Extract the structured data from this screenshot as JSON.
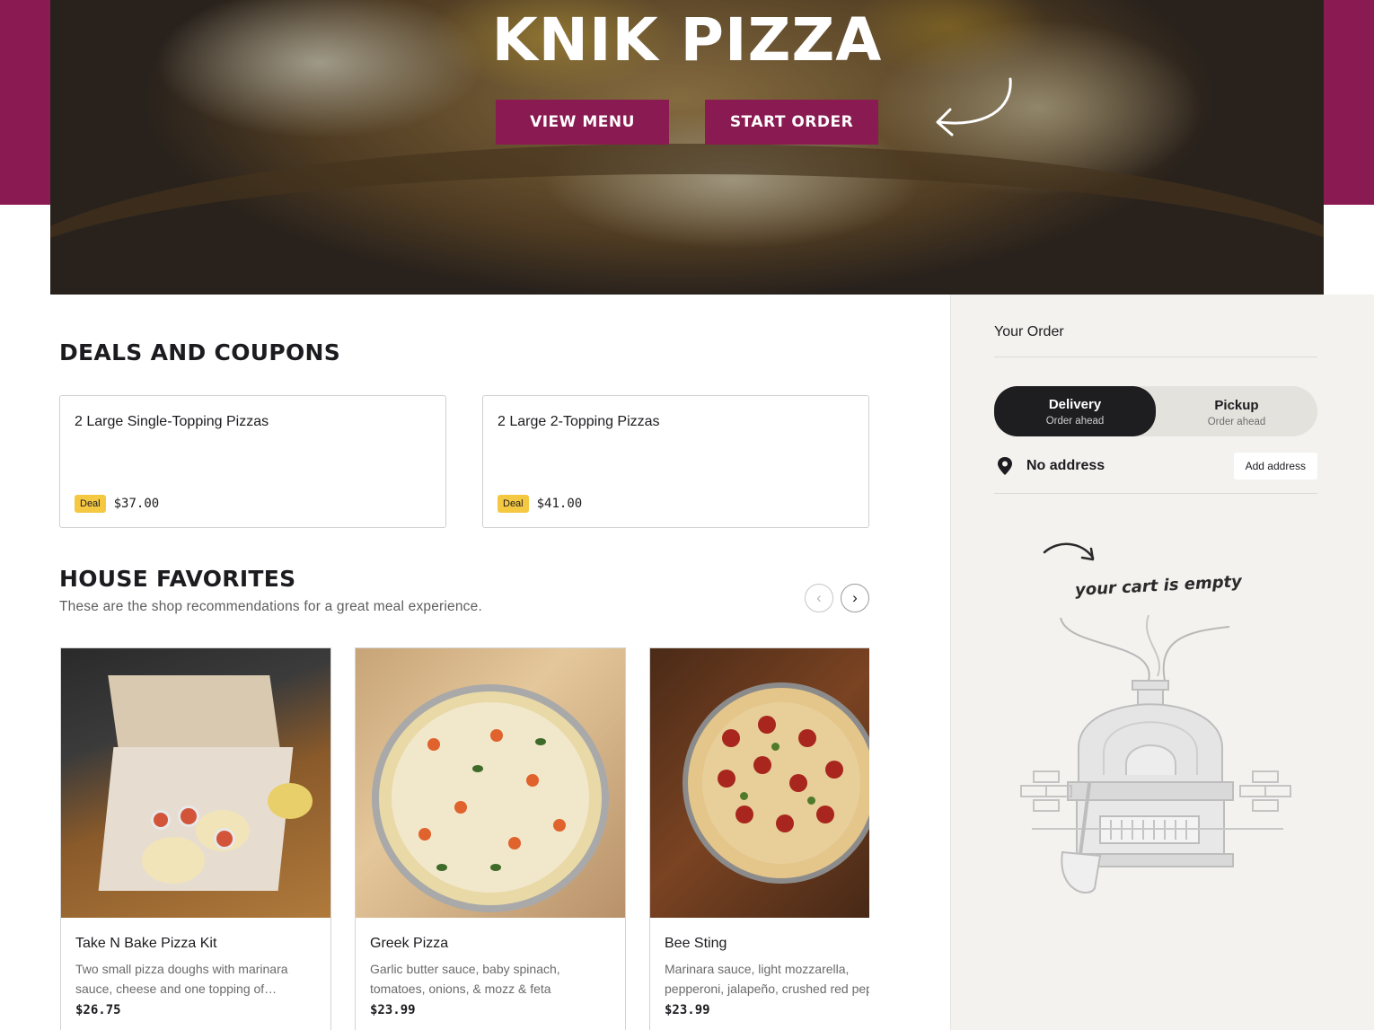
{
  "hero": {
    "title": "KNIK PIZZA",
    "view_menu_label": "VIEW MENU",
    "start_order_label": "START ORDER"
  },
  "deals": {
    "title": "DEALS AND COUPONS",
    "items": [
      {
        "name": "2 Large Single-Topping Pizzas",
        "badge": "Deal",
        "price": "$37.00"
      },
      {
        "name": "2 Large 2-Topping Pizzas",
        "badge": "Deal",
        "price": "$41.00"
      }
    ]
  },
  "favorites": {
    "title": "HOUSE FAVORITES",
    "subtitle": "These are the shop recommendations for a great meal experience.",
    "prev_icon": "chevron-left-icon",
    "next_icon": "chevron-right-icon",
    "items": [
      {
        "name": "Take N Bake Pizza Kit",
        "description": "Two small pizza doughs with marinara sauce, cheese and one topping of…",
        "price": "$26.75"
      },
      {
        "name": "Greek Pizza",
        "description": "Garlic butter sauce, baby spinach, tomatoes, onions, & mozz & feta",
        "price": "$23.99"
      },
      {
        "name": "Bee Sting",
        "description": "Marinara sauce, light mozzarella, pepperoni, jalapeño, crushed red pep",
        "price": "$23.99"
      }
    ]
  },
  "order": {
    "title": "Your Order",
    "delivery": {
      "label": "Delivery",
      "sub": "Order ahead",
      "selected": true
    },
    "pickup": {
      "label": "Pickup",
      "sub": "Order ahead",
      "selected": false
    },
    "address_text": "No address",
    "add_address_label": "Add address",
    "empty_text": "your cart is empty"
  },
  "colors": {
    "brand": "#8a1a52",
    "deal_badge": "#f5c842",
    "toggle_active": "#1e1d20",
    "sidebar_bg": "#f3f2ef"
  }
}
